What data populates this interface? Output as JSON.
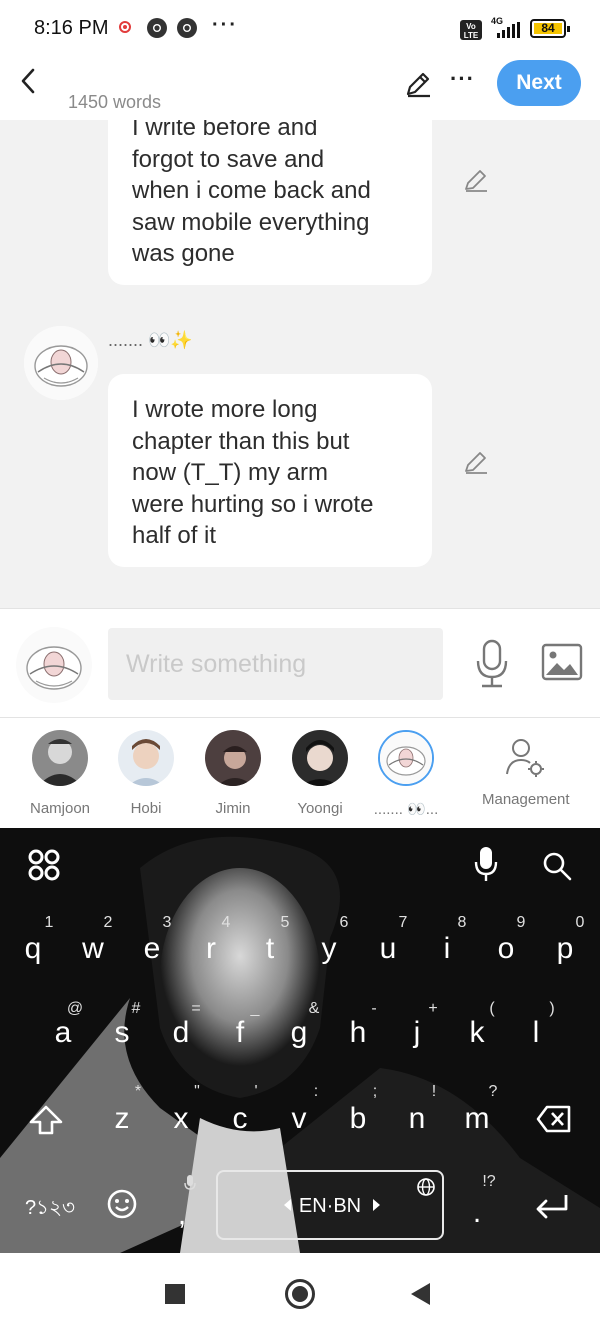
{
  "status_bar": {
    "time": "8:16 PM",
    "volte": "Vo LTE",
    "network": "4G",
    "battery": "84",
    "battery_color": "#f5c400",
    "more": "···"
  },
  "header": {
    "word_count": "1450 words",
    "next_label": "Next",
    "more": "···",
    "accent": "#4b9ff0"
  },
  "messages": [
    {
      "lines": [
        "I write before and",
        "forgot to save and",
        "when i come back and",
        "saw mobile everything",
        "was gone"
      ]
    },
    {
      "author": "....... 👀✨",
      "lines": [
        "I wrote more long",
        "chapter than this but",
        "now (T_T) my arm",
        "were hurting so i wrote",
        "half of it"
      ]
    }
  ],
  "composer": {
    "placeholder": "Write something"
  },
  "characters": [
    {
      "name": "Namjoon",
      "color": "#6e6e6e"
    },
    {
      "name": "Hobi",
      "color": "#d9c3b0"
    },
    {
      "name": "Jimin",
      "color": "#5b4a4a"
    },
    {
      "name": "Yoongi",
      "color": "#3a3a3a"
    },
    {
      "name": "....... 👀...",
      "color": "#f4f4f4"
    },
    {
      "name": "Management",
      "color": "#ffffff"
    }
  ],
  "keyboard": {
    "row1_keys": [
      "q",
      "w",
      "e",
      "r",
      "t",
      "y",
      "u",
      "i",
      "o",
      "p"
    ],
    "row1_hints": [
      "1",
      "2",
      "3",
      "4",
      "5",
      "6",
      "7",
      "8",
      "9",
      "0"
    ],
    "row2_keys": [
      "a",
      "s",
      "d",
      "f",
      "g",
      "h",
      "j",
      "k",
      "l"
    ],
    "row2_hints": [
      "@",
      "#",
      "=",
      "_",
      "&",
      "-",
      "+",
      "(",
      ")"
    ],
    "row3_keys": [
      "z",
      "x",
      "c",
      "v",
      "b",
      "n",
      "m"
    ],
    "row3_hints": [
      "*",
      "\"",
      "'",
      ":",
      ";",
      "!",
      "?"
    ],
    "symbols_label": "?১২৩",
    "comma": ",",
    "period": ".",
    "period_hint": "!?",
    "language": "EN·BN"
  }
}
